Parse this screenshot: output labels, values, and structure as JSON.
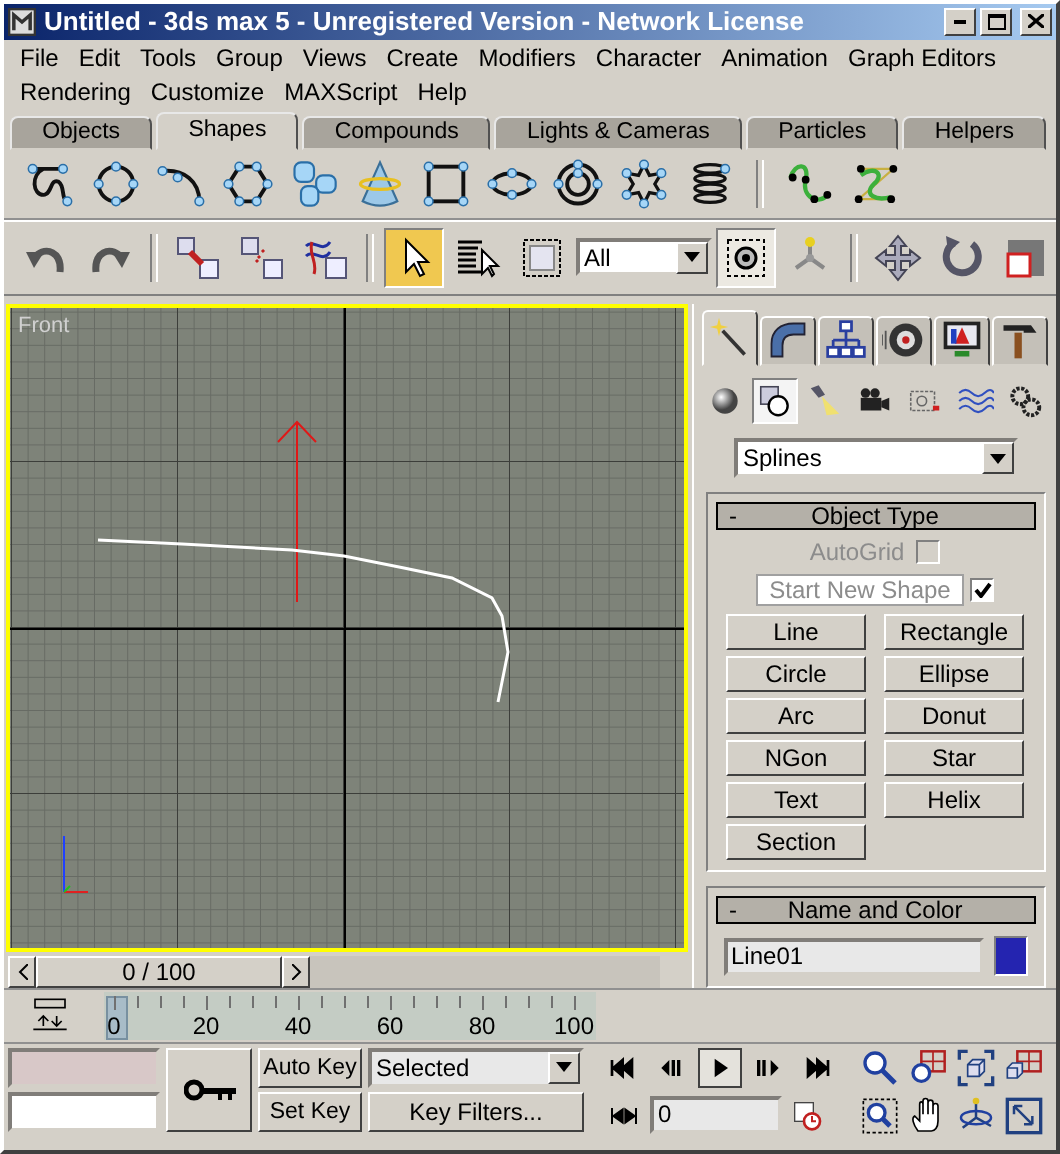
{
  "window": {
    "title": "Untitled - 3ds max 5 - Unregistered Version - Network License"
  },
  "menu_rows": [
    {
      "items": [
        "File",
        "Edit",
        "Tools",
        "Group",
        "Views",
        "Create",
        "Modifiers",
        "Character",
        "Animation",
        "Graph Editors"
      ]
    },
    {
      "items": [
        "Rendering",
        "Customize",
        "MAXScript",
        "Help"
      ]
    }
  ],
  "tabs": [
    {
      "label": "Objects",
      "selected": false
    },
    {
      "label": "Shapes",
      "selected": true
    },
    {
      "label": "Compounds",
      "selected": false
    },
    {
      "label": "Lights & Cameras",
      "selected": false
    },
    {
      "label": "Particles",
      "selected": false
    },
    {
      "label": "Helpers",
      "selected": false
    }
  ],
  "toolbar": {
    "groups": [
      {
        "tools": [
          {
            "kind": "undo",
            "selected": false
          },
          {
            "kind": "redo",
            "selected": false
          }
        ]
      },
      {
        "tools": [
          {
            "kind": "link",
            "selected": false
          },
          {
            "kind": "unlink",
            "selected": false
          },
          {
            "kind": "bind",
            "selected": false
          }
        ]
      },
      {
        "tools": [
          {
            "kind": "select",
            "selected": true
          },
          {
            "kind": "select-by-name",
            "selected": false
          },
          {
            "kind": "region",
            "selected": false
          },
          {
            "kind": "filter",
            "value": "All"
          },
          {
            "kind": "window-crossing",
            "selected": true
          },
          {
            "kind": "pivot",
            "selected": false
          }
        ]
      },
      {
        "tools": [
          {
            "kind": "move",
            "selected": false
          },
          {
            "kind": "rotate",
            "selected": false
          },
          {
            "kind": "scale",
            "selected": false
          }
        ]
      }
    ]
  },
  "viewport": {
    "label": "Front",
    "active": true
  },
  "time_slider": {
    "position": "0 / 100"
  },
  "track_bar": {
    "labels": [
      "0",
      "20",
      "40",
      "60",
      "80",
      "100"
    ]
  },
  "command_panel": {
    "tabs": [
      {
        "kind": "create",
        "selected": true
      },
      {
        "kind": "modify",
        "selected": false
      },
      {
        "kind": "hierarchy",
        "selected": false
      },
      {
        "kind": "motion",
        "selected": false
      },
      {
        "kind": "display",
        "selected": false
      },
      {
        "kind": "utilities",
        "selected": false
      }
    ],
    "categories": [
      {
        "kind": "geometry",
        "selected": false
      },
      {
        "kind": "shapes",
        "selected": true
      },
      {
        "kind": "lights",
        "selected": false
      },
      {
        "kind": "cameras",
        "selected": false
      },
      {
        "kind": "helpers",
        "selected": false
      },
      {
        "kind": "space-warps",
        "selected": false
      },
      {
        "kind": "systems",
        "selected": false
      }
    ],
    "dropdown": "Splines",
    "object_type": {
      "toggle": "-",
      "title": "Object Type",
      "autogrid": {
        "label": "AutoGrid",
        "checked": false,
        "disabled": true
      },
      "start_new_shape": {
        "label": "Start New Shape",
        "checked": true
      },
      "buttons": [
        "Line",
        "Rectangle",
        "Circle",
        "Ellipse",
        "Arc",
        "Donut",
        "NGon",
        "Star",
        "Text",
        "Helix",
        "Section"
      ]
    },
    "name_and_color": {
      "toggle": "-",
      "title": "Name and Color",
      "name": "Line01",
      "color": "#2424b0"
    }
  },
  "animation": {
    "auto_key": "Auto Key",
    "set_key": "Set Key",
    "key_mode": "Selected",
    "key_filters": "Key Filters...",
    "frame": "0"
  },
  "playback": [
    {
      "kind": "go-start",
      "selected": false
    },
    {
      "kind": "prev-frame",
      "selected": false
    },
    {
      "kind": "play",
      "selected": true
    },
    {
      "kind": "next-frame",
      "selected": false
    },
    {
      "kind": "go-end",
      "selected": false
    }
  ]
}
